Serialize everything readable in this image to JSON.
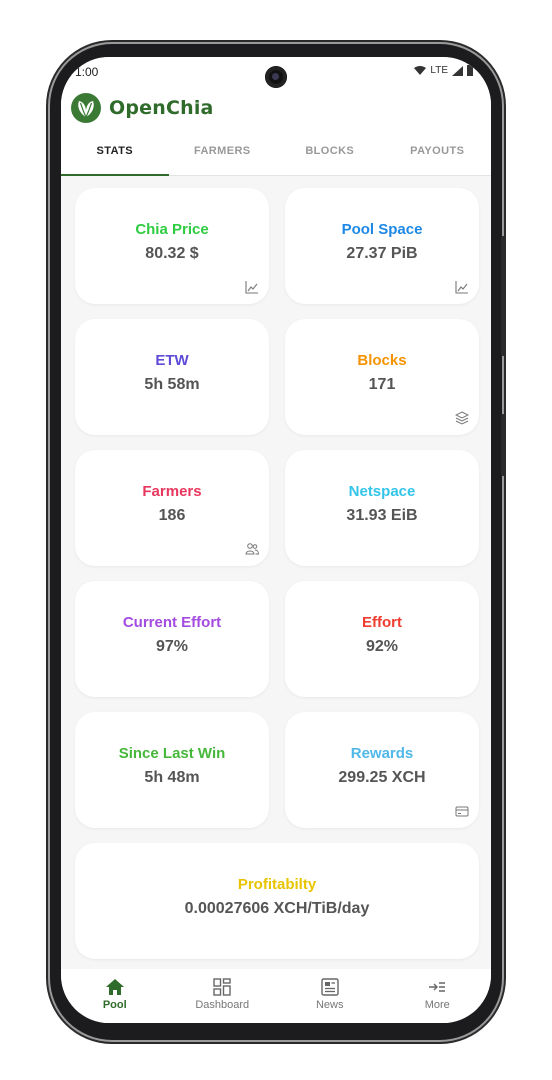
{
  "status": {
    "time": "1:00",
    "network": "LTE"
  },
  "app": {
    "name": "OpenChia"
  },
  "tabs": [
    "STATS",
    "FARMERS",
    "BLOCKS",
    "PAYOUTS"
  ],
  "cards": [
    {
      "title": "Chia Price",
      "value": "80.32 $",
      "color": "#2ecc40",
      "icon": "chart-line-icon"
    },
    {
      "title": "Pool Space",
      "value": "27.37 PiB",
      "color": "#1e88e5",
      "icon": "chart-line-icon"
    },
    {
      "title": "ETW",
      "value": "5h 58m",
      "color": "#5e4bd8",
      "icon": ""
    },
    {
      "title": "Blocks",
      "value": "171",
      "color": "#f59300",
      "icon": "layers-icon"
    },
    {
      "title": "Farmers",
      "value": "186",
      "color": "#e8375d",
      "icon": "users-icon"
    },
    {
      "title": "Netspace",
      "value": "31.93 EiB",
      "color": "#33c5e8",
      "icon": ""
    },
    {
      "title": "Current Effort",
      "value": "97%",
      "color": "#a44be0",
      "icon": ""
    },
    {
      "title": "Effort",
      "value": "92%",
      "color": "#f03c2e",
      "icon": ""
    },
    {
      "title": "Since Last Win",
      "value": "5h 48m",
      "color": "#45b83a",
      "icon": ""
    },
    {
      "title": "Rewards",
      "value": "299.25 XCH",
      "color": "#4fb8e8",
      "icon": "card-icon"
    },
    {
      "title": "Profitabilty",
      "value": "0.00027606 XCH/TiB/day",
      "color": "#e8c400",
      "icon": ""
    }
  ],
  "nav": [
    {
      "label": "Pool",
      "icon": "home-icon"
    },
    {
      "label": "Dashboard",
      "icon": "dashboard-icon"
    },
    {
      "label": "News",
      "icon": "news-icon"
    },
    {
      "label": "More",
      "icon": "more-icon"
    }
  ]
}
